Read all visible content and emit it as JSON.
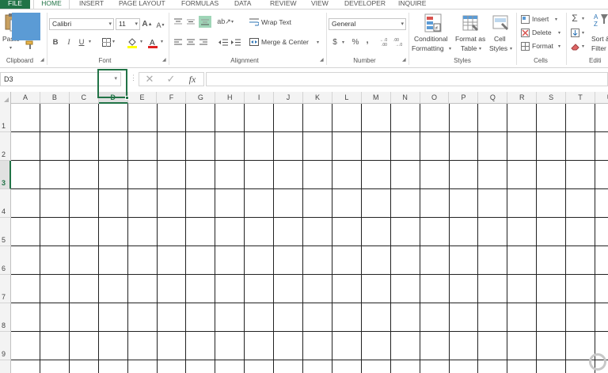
{
  "tabs": [
    {
      "label": "FILE"
    },
    {
      "label": "HOME"
    },
    {
      "label": "INSERT"
    },
    {
      "label": "PAGE LAYOUT"
    },
    {
      "label": "FORMULAS"
    },
    {
      "label": "DATA"
    },
    {
      "label": "REVIEW"
    },
    {
      "label": "VIEW"
    },
    {
      "label": "DEVELOPER"
    },
    {
      "label": "INQUIRE"
    }
  ],
  "ribbon": {
    "clipboard": {
      "paste_label": "Paste",
      "group_label": "Clipboard"
    },
    "font": {
      "font_name": "Calibri",
      "font_size": "11",
      "bold": "B",
      "italic": "I",
      "underline": "U",
      "group_label": "Font"
    },
    "alignment": {
      "wrap_text": "Wrap Text",
      "merge_center": "Merge & Center",
      "group_label": "Alignment"
    },
    "number": {
      "format": "General",
      "currency": "$",
      "percent": "%",
      "comma": ",",
      "group_label": "Number"
    },
    "styles": {
      "conditional_formatting_1": "Conditional",
      "conditional_formatting_2": "Formatting",
      "format_as_table_1": "Format as",
      "format_as_table_2": "Table",
      "cell_styles_1": "Cell",
      "cell_styles_2": "Styles",
      "group_label": "Styles"
    },
    "cells": {
      "insert": "Insert",
      "delete": "Delete",
      "format": "Format",
      "group_label": "Cells"
    },
    "editing": {
      "sort_filter_1": "Sort &",
      "sort_filter_2": "Filter",
      "group_label": "Editi"
    }
  },
  "formula_bar": {
    "name_box": "D3",
    "cancel": "✕",
    "enter": "✓",
    "fx": "fx",
    "value": ""
  },
  "grid": {
    "columns": [
      "A",
      "B",
      "C",
      "D",
      "E",
      "F",
      "G",
      "H",
      "I",
      "J",
      "K",
      "L",
      "M",
      "N",
      "O",
      "P",
      "Q",
      "R",
      "S",
      "T",
      "U"
    ],
    "rows": [
      "1",
      "2",
      "3",
      "4",
      "5",
      "6",
      "7",
      "8",
      "9"
    ],
    "active_cell": "D3",
    "highlight_color": "#5b9bd5",
    "accent_color": "#217346"
  }
}
